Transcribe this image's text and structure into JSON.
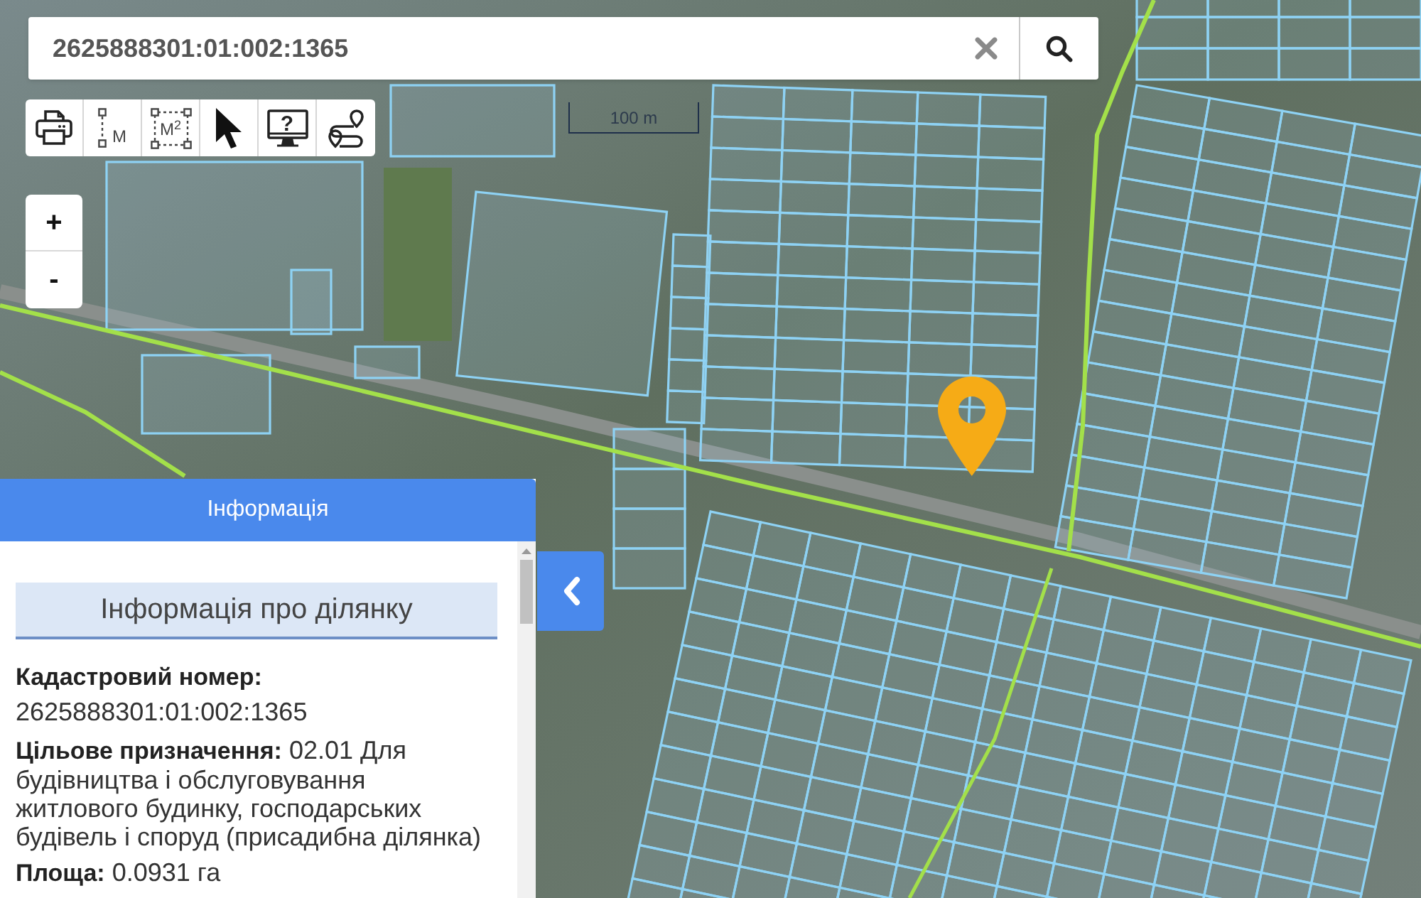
{
  "search": {
    "value": "2625888301:01:002:1365"
  },
  "toolbar": [
    {
      "kind": "print"
    },
    {
      "kind": "distance",
      "label": "M"
    },
    {
      "kind": "area",
      "label": "M$^{2}$"
    },
    {
      "kind": "select"
    },
    {
      "kind": "help",
      "label": "?"
    },
    {
      "kind": "route"
    }
  ],
  "scale": {
    "label": "100 m"
  },
  "zoom": {
    "in_label": "+",
    "out_label": "-"
  },
  "info_panel": {
    "title": "Інформація",
    "section_title": "Інформація про ділянку",
    "fields": [
      {
        "kind": "stacked",
        "label": "Кадастровий номер:",
        "value": "2625888301:01:002:1365"
      },
      {
        "kind": "inline",
        "label": "Цільове призначення:",
        "value": "02.01 Для будівництва і обслуговування житлового будинку, господарських будівель і споруд (присадибна ділянка)"
      },
      {
        "kind": "inline",
        "label": "Площа:",
        "value": "0.0931 га"
      }
    ]
  }
}
